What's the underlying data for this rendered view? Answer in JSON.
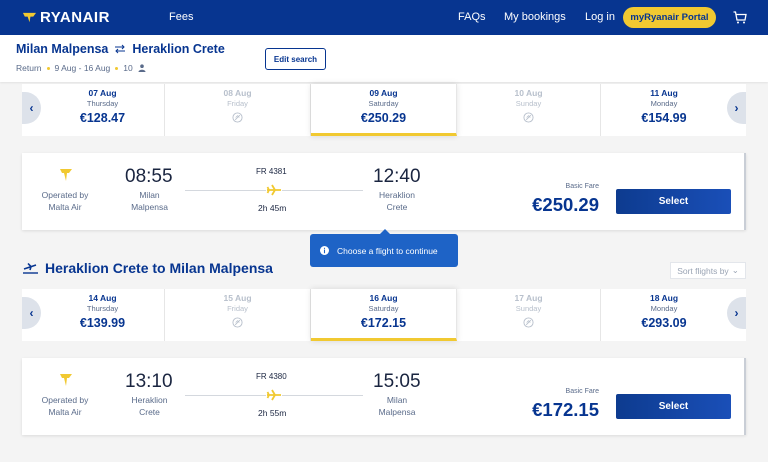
{
  "nav": {
    "brand": "RYANAIR",
    "fees": "Fees",
    "faqs": "FAQs",
    "my_bookings": "My bookings",
    "login": "Log in",
    "portal": "myRyanair Portal"
  },
  "search": {
    "origin": "Milan Malpensa",
    "destination": "Heraklion Crete",
    "trip_type": "Return",
    "dates": "9 Aug - 16 Aug",
    "passengers": "10",
    "edit": "Edit search"
  },
  "outbound": {
    "dates": [
      {
        "date": "07 Aug",
        "day": "Thursday",
        "price": "€128.47",
        "available": true,
        "selected": false
      },
      {
        "date": "08 Aug",
        "day": "Friday",
        "price": "",
        "available": false,
        "selected": false
      },
      {
        "date": "09 Aug",
        "day": "Saturday",
        "price": "€250.29",
        "available": true,
        "selected": true
      },
      {
        "date": "10 Aug",
        "day": "Sunday",
        "price": "",
        "available": false,
        "selected": false
      },
      {
        "date": "11 Aug",
        "day": "Monday",
        "price": "€154.99",
        "available": true,
        "selected": false
      }
    ],
    "flight": {
      "operator": "Operated by Malta Air",
      "operator_line1": "Operated by",
      "operator_line2": "Malta Air",
      "dep_time": "08:55",
      "dep_city1": "Milan",
      "dep_city2": "Malpensa",
      "flight_no": "FR 4381",
      "duration": "2h 45m",
      "arr_time": "12:40",
      "arr_city1": "Heraklion",
      "arr_city2": "Crete",
      "fare_label": "Basic Fare",
      "price": "€250.29",
      "select": "Select"
    }
  },
  "tooltip": "Choose a flight to continue",
  "return": {
    "heading": "Heraklion Crete to Milan Malpensa",
    "sort": "Sort flights by",
    "dates": [
      {
        "date": "14 Aug",
        "day": "Thursday",
        "price": "€139.99",
        "available": true,
        "selected": false
      },
      {
        "date": "15 Aug",
        "day": "Friday",
        "price": "",
        "available": false,
        "selected": false
      },
      {
        "date": "16 Aug",
        "day": "Saturday",
        "price": "€172.15",
        "available": true,
        "selected": true
      },
      {
        "date": "17 Aug",
        "day": "Sunday",
        "price": "",
        "available": false,
        "selected": false
      },
      {
        "date": "18 Aug",
        "day": "Monday",
        "price": "€293.09",
        "available": true,
        "selected": false
      }
    ],
    "flight": {
      "operator_line1": "Operated by",
      "operator_line2": "Malta Air",
      "dep_time": "13:10",
      "dep_city1": "Heraklion",
      "dep_city2": "Crete",
      "flight_no": "FR 4380",
      "duration": "2h 55m",
      "arr_time": "15:05",
      "arr_city1": "Milan",
      "arr_city2": "Malpensa",
      "fare_label": "Basic Fare",
      "price": "€172.15",
      "select": "Select"
    }
  },
  "colors": {
    "brand_blue": "#073590",
    "accent_yellow": "#f1c931",
    "tooltip_blue": "#1e63c6"
  }
}
